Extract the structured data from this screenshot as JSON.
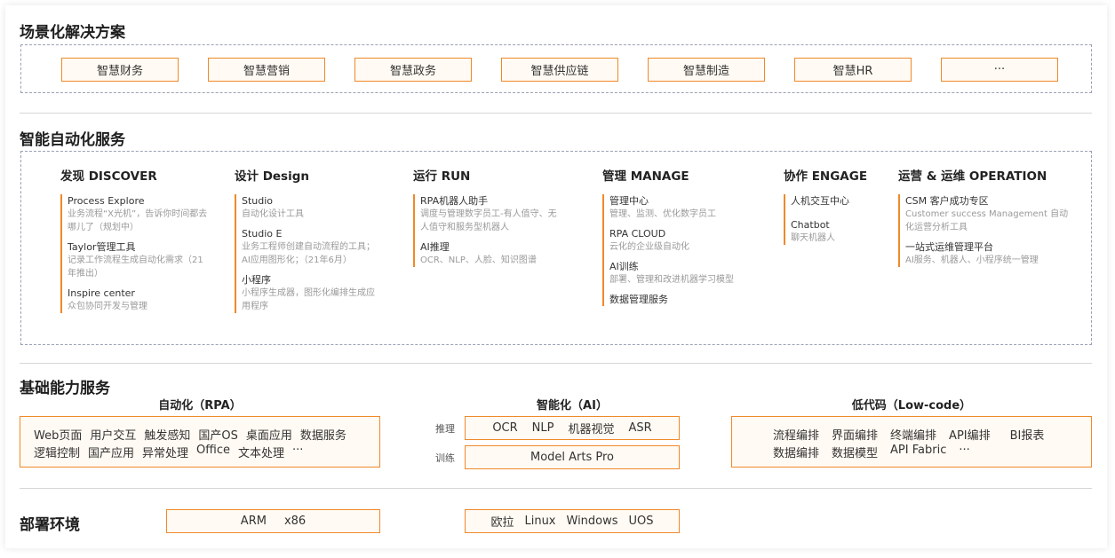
{
  "scenario": {
    "title": "场景化解决方案",
    "items": [
      "智慧财务",
      "智慧营销",
      "智慧政务",
      "智慧供应链",
      "智慧制造",
      "智慧HR",
      "···"
    ]
  },
  "ai_services": {
    "title": "智能自动化服务",
    "columns": [
      {
        "heading": "发现 DISCOVER",
        "groups": [
          {
            "title": "Process Explore",
            "desc": "业务流程“X光机”，告诉你时间都去哪儿了（规划中）"
          },
          {
            "title": "Taylor管理工具",
            "desc": "记录工作流程生成自动化需求（21年推出）"
          },
          {
            "title": "Inspire center",
            "desc": "众包协同开发与管理"
          }
        ]
      },
      {
        "heading": "设计 Design",
        "groups": [
          {
            "title": "Studio",
            "desc": "自动化设计工具"
          },
          {
            "title": "Studio E",
            "desc": "业务工程师创建自动流程的工具；AI应用图形化；（21年6月）"
          },
          {
            "title": "小程序",
            "desc": "小程序生成器，图形化编排生成应用程序"
          }
        ]
      },
      {
        "heading": "运行 RUN",
        "groups": [
          {
            "title": "RPA机器人助手",
            "desc": "调度与管理数字员工-有人值守、无人值守和服务型机器人"
          },
          {
            "title": "AI推理",
            "desc": "OCR、NLP、人脸、知识图谱"
          }
        ]
      },
      {
        "heading": "管理 MANAGE",
        "groups": [
          {
            "title": "管理中心",
            "desc": "管理、监测、优化数字员工"
          },
          {
            "title": "RPA CLOUD",
            "desc": "云化的企业级自动化"
          },
          {
            "title": "AI训练",
            "desc": "部署、管理和改进机器学习模型"
          },
          {
            "title": "数据管理服务",
            "desc": ""
          }
        ]
      },
      {
        "heading": "协作 ENGAGE",
        "groups": [
          {
            "title": "人机交互中心",
            "desc": ""
          },
          {
            "title": "Chatbot",
            "desc": "聊天机器人"
          }
        ]
      },
      {
        "heading": "运营 & 运维 OPERATION",
        "groups": [
          {
            "title": "CSM 客户成功专区",
            "desc": "Customer success Management 自动化运营分析工具"
          },
          {
            "title": "一站式运维管理平台",
            "desc": "AI服务、机器人、小程序统一管理"
          }
        ]
      }
    ]
  },
  "base": {
    "title": "基础能力服务",
    "rpa": {
      "heading": "自动化（RPA）",
      "row1": [
        "Web页面",
        "用户交互",
        "触发感知",
        "国产OS",
        "桌面应用",
        "数据服务"
      ],
      "row2": [
        "逻辑控制",
        "国产应用",
        "异常处理",
        "Office",
        "文本处理",
        "···"
      ]
    },
    "ai": {
      "heading": "智能化（AI）",
      "infer_label": "推理",
      "infer_items": [
        "OCR",
        "NLP",
        "机器视觉",
        "ASR"
      ],
      "train_label": "训练",
      "train_item": "Model Arts Pro"
    },
    "lowcode": {
      "heading": "低代码（Low-code）",
      "row1": [
        "流程编排",
        "界面编排",
        "终端编排",
        "API编排",
        "BI报表"
      ],
      "row2": [
        "数据编排",
        "数据模型",
        "API Fabric",
        "···"
      ]
    }
  },
  "deploy": {
    "title": "部署环境",
    "hw": [
      "ARM",
      "x86"
    ],
    "os": [
      "欧拉",
      "Linux",
      "Windows",
      "UOS"
    ]
  },
  "colors": {
    "accent": "#f0892a",
    "accent_bg": "#fffaf3",
    "dash": "#9aa0b4"
  }
}
